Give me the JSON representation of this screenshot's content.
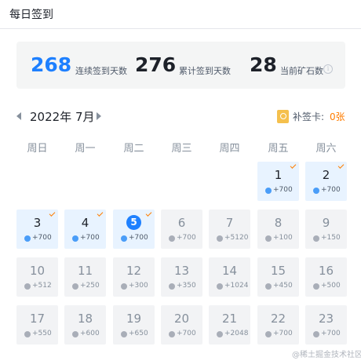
{
  "header": {
    "title": "每日签到"
  },
  "stats": {
    "consecutive_days": "268",
    "consecutive_label": "连续签到天数",
    "total_days": "276",
    "total_label": "累计签到天数",
    "ore": "28",
    "ore_label": "当前矿石数",
    "info_glyph": "i"
  },
  "calendar": {
    "month_label": "2022年 7月",
    "makeup_label": "补签卡:",
    "makeup_count": "0张",
    "weekdays": [
      "周日",
      "周一",
      "周二",
      "周三",
      "周四",
      "周五",
      "周六"
    ],
    "days": [
      {
        "day": "1",
        "points": "+700",
        "checked": true,
        "today": false
      },
      {
        "day": "2",
        "points": "+700",
        "checked": true,
        "today": false
      },
      {
        "day": "3",
        "points": "+700",
        "checked": true,
        "today": false
      },
      {
        "day": "4",
        "points": "+700",
        "checked": true,
        "today": false
      },
      {
        "day": "5",
        "points": "+700",
        "checked": true,
        "today": true
      },
      {
        "day": "6",
        "points": "+700",
        "checked": false,
        "today": false
      },
      {
        "day": "7",
        "points": "+5120",
        "checked": false,
        "today": false
      },
      {
        "day": "8",
        "points": "+100",
        "checked": false,
        "today": false
      },
      {
        "day": "9",
        "points": "+150",
        "checked": false,
        "today": false
      },
      {
        "day": "10",
        "points": "+512",
        "checked": false,
        "today": false
      },
      {
        "day": "11",
        "points": "+250",
        "checked": false,
        "today": false
      },
      {
        "day": "12",
        "points": "+300",
        "checked": false,
        "today": false
      },
      {
        "day": "13",
        "points": "+350",
        "checked": false,
        "today": false
      },
      {
        "day": "14",
        "points": "+1024",
        "checked": false,
        "today": false
      },
      {
        "day": "15",
        "points": "+450",
        "checked": false,
        "today": false
      },
      {
        "day": "16",
        "points": "+500",
        "checked": false,
        "today": false
      },
      {
        "day": "17",
        "points": "+550",
        "checked": false,
        "today": false
      },
      {
        "day": "18",
        "points": "+600",
        "checked": false,
        "today": false
      },
      {
        "day": "19",
        "points": "+650",
        "checked": false,
        "today": false
      },
      {
        "day": "20",
        "points": "+700",
        "checked": false,
        "today": false
      },
      {
        "day": "21",
        "points": "+2048",
        "checked": false,
        "today": false
      },
      {
        "day": "22",
        "points": "+700",
        "checked": false,
        "today": false
      },
      {
        "day": "23",
        "points": "+700",
        "checked": false,
        "today": false
      }
    ]
  },
  "watermark": "@稀土掘金技术社区",
  "colors": {
    "accent": "#1e80ff",
    "checked_bg": "#e8f3ff",
    "pending_bg": "#f2f3f5",
    "check_mark": "#ff7d00"
  },
  "icons": {
    "gem": "ore-gem-icon",
    "check": "checkmark-icon",
    "card": "makeup-card-icon",
    "info": "info-circle-icon"
  }
}
